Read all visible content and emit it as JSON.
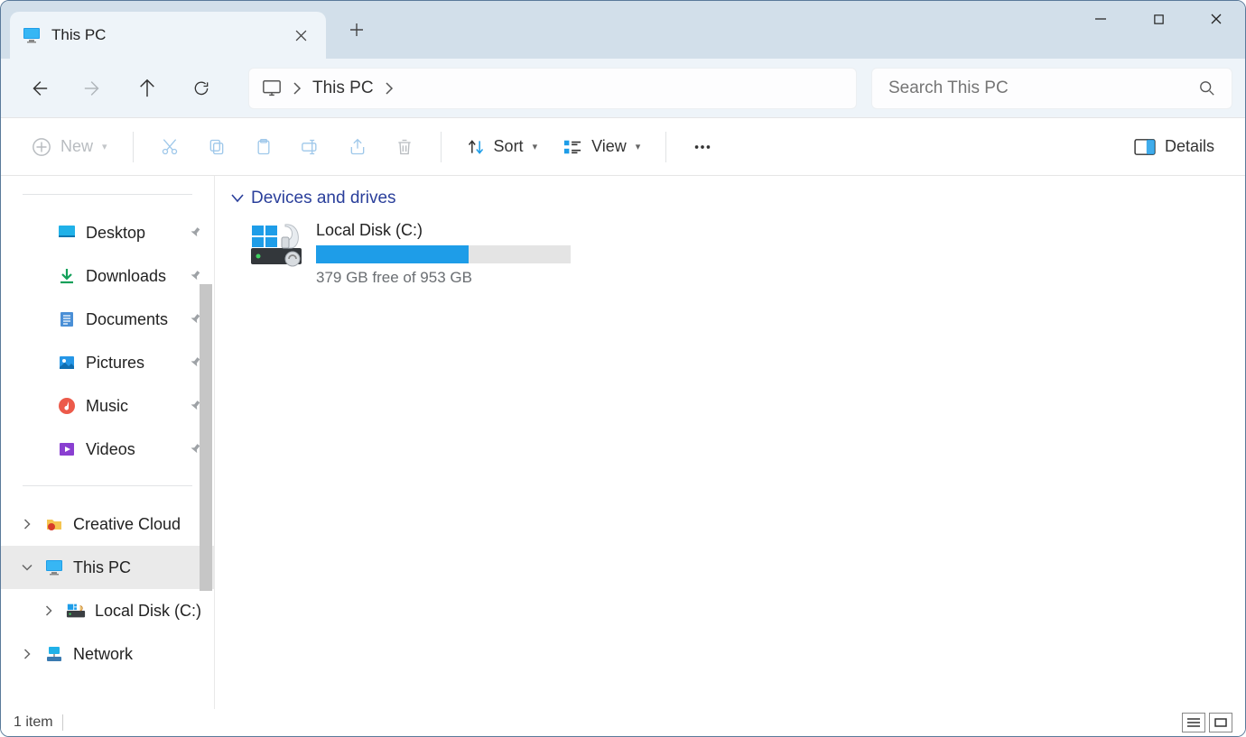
{
  "titlebar": {
    "tab_title": "This PC"
  },
  "address": {
    "crumb": "This PC"
  },
  "search": {
    "placeholder": "Search This PC"
  },
  "toolbar": {
    "new_label": "New",
    "sort_label": "Sort",
    "view_label": "View",
    "details_label": "Details"
  },
  "sidebar": {
    "quick": [
      {
        "label": "Desktop",
        "icon": "desktop"
      },
      {
        "label": "Downloads",
        "icon": "downloads"
      },
      {
        "label": "Documents",
        "icon": "documents"
      },
      {
        "label": "Pictures",
        "icon": "pictures"
      },
      {
        "label": "Music",
        "icon": "music"
      },
      {
        "label": "Videos",
        "icon": "videos"
      }
    ],
    "tree": [
      {
        "label": "Creative Cloud F",
        "icon": "cc",
        "expand": "right",
        "indent": 1
      },
      {
        "label": "This PC",
        "icon": "thispc",
        "expand": "down",
        "indent": 1,
        "selected": true
      },
      {
        "label": "Local Disk (C:)",
        "icon": "disk",
        "expand": "right",
        "indent": 2
      },
      {
        "label": "Network",
        "icon": "network",
        "expand": "right",
        "indent": 1
      }
    ]
  },
  "content": {
    "group_header": "Devices and drives",
    "drive": {
      "name": "Local Disk (C:)",
      "free_text": "379 GB free of 953 GB",
      "used_percent": 60
    }
  },
  "statusbar": {
    "count_text": "1 item"
  }
}
